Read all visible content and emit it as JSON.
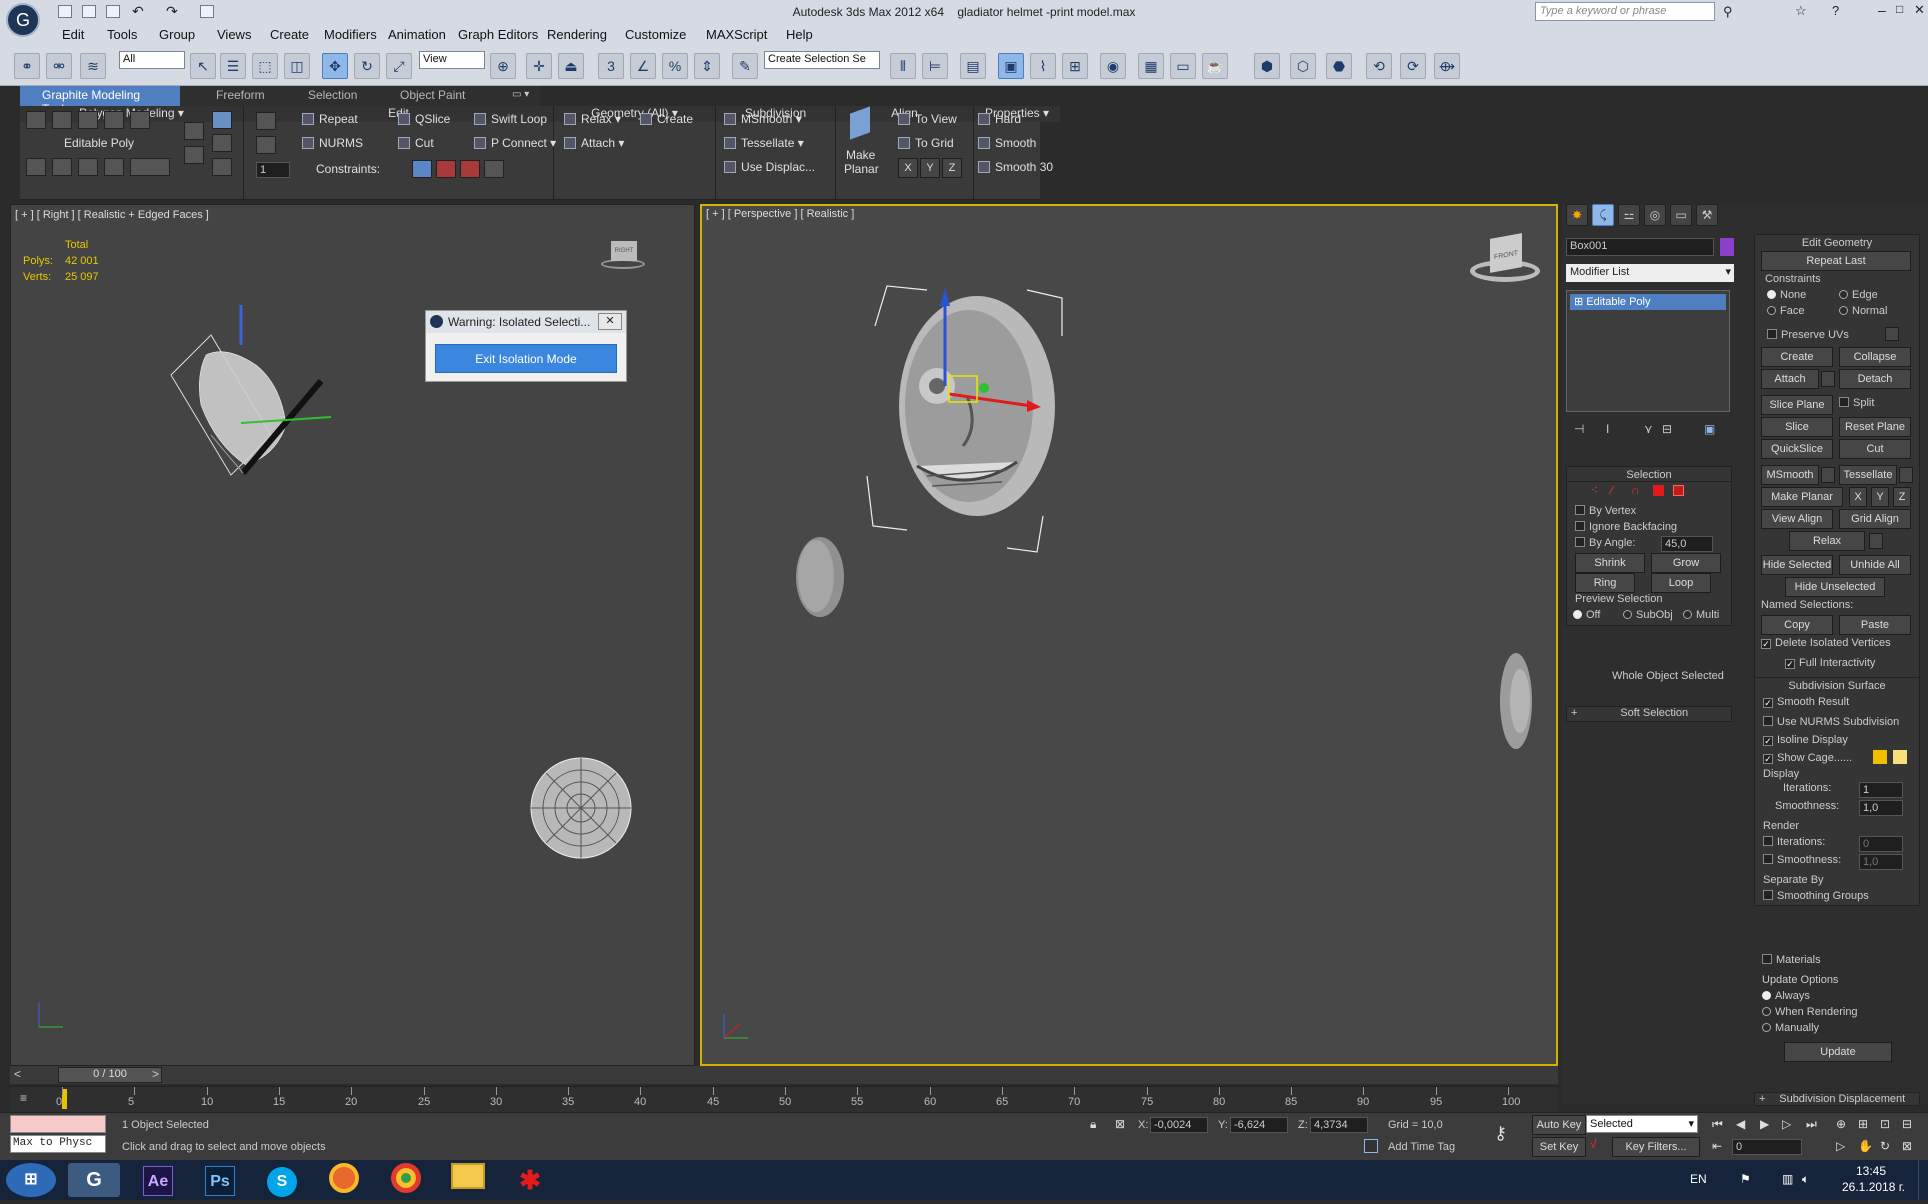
{
  "titlebar": {
    "app": "Autodesk 3ds Max  2012 x64",
    "file": "gladiator helmet -print model.max",
    "search_placeholder": "Type a keyword or phrase"
  },
  "menu": [
    "Edit",
    "Tools",
    "Group",
    "Views",
    "Create",
    "Modifiers",
    "Animation",
    "Graph Editors",
    "Rendering",
    "Customize",
    "MAXScript",
    "Help"
  ],
  "toolbar": {
    "selection_filter": "All",
    "ref_coord": "View",
    "named_selection": "Create Selection Se"
  },
  "ribbon_tabs": [
    "Graphite Modeling Tools",
    "Freeform",
    "Selection",
    "Object Paint"
  ],
  "ribbon": {
    "polygon_modeling": {
      "label": "Polygon Modeling",
      "sub": "Editable Poly",
      "spinner": "1"
    },
    "edit": {
      "label": "Edit",
      "repeat": "Repeat",
      "qslice": "QSlice",
      "swift_loop": "Swift Loop",
      "nurms": "NURMS",
      "cut": "Cut",
      "p_connect": "P Connect",
      "constraints": "Constraints:"
    },
    "geometry": {
      "label": "Geometry (All)",
      "relax": "Relax",
      "create": "Create",
      "attach": "Attach"
    },
    "subdivision": {
      "label": "Subdivision",
      "msmooth": "MSmooth",
      "tessellate": "Tessellate",
      "use_displace": "Use Displac..."
    },
    "align": {
      "label": "Align",
      "make_planar_1": "Make",
      "make_planar_2": "Planar",
      "to_view": "To View",
      "to_grid": "To Grid",
      "x": "X",
      "y": "Y",
      "z": "Z"
    },
    "properties": {
      "label": "Properties",
      "hard": "Hard",
      "smooth": "Smooth",
      "smooth30": "Smooth 30"
    }
  },
  "viewport_left": {
    "label": "[ + ] [ Right ] [ Realistic + Edged Faces ]",
    "stats_total": "Total",
    "polys_label": "Polys:",
    "polys": "42 001",
    "verts_label": "Verts:",
    "verts": "25 097",
    "viewcube": "RIGHT"
  },
  "viewport_right": {
    "label": "[ + ] [ Perspective ] [ Realistic ]",
    "viewcube": "FRONT"
  },
  "warning": {
    "title": "Warning: Isolated Selecti...",
    "button": "Exit Isolation Mode"
  },
  "command_panel": {
    "object_name": "Box001",
    "object_color": "#8e3fc9",
    "modifier_list": "Modifier List",
    "stack_item": "Editable Poly",
    "selection": {
      "title": "Selection",
      "by_vertex": "By Vertex",
      "ignore_backfacing": "Ignore Backfacing",
      "by_angle": "By Angle:",
      "angle": "45,0",
      "shrink": "Shrink",
      "grow": "Grow",
      "ring": "Ring",
      "loop": "Loop",
      "preview": "Preview Selection",
      "off": "Off",
      "subobj": "SubObj",
      "multi": "Multi",
      "whole": "Whole Object Selected"
    },
    "soft_selection": "Soft Selection",
    "edit_geometry": {
      "title": "Edit Geometry",
      "repeat_last": "Repeat Last",
      "constraints": "Constraints",
      "none": "None",
      "edge": "Edge",
      "face": "Face",
      "normal": "Normal",
      "preserve_uvs": "Preserve UVs",
      "create": "Create",
      "collapse": "Collapse",
      "attach": "Attach",
      "detach": "Detach",
      "slice_plane": "Slice Plane",
      "split": "Split",
      "slice": "Slice",
      "reset_plane": "Reset Plane",
      "quickslice": "QuickSlice",
      "cut": "Cut",
      "msmooth": "MSmooth",
      "tessellate": "Tessellate",
      "make_planar": "Make Planar",
      "x": "X",
      "y": "Y",
      "z": "Z",
      "view_align": "View Align",
      "grid_align": "Grid Align",
      "relax": "Relax",
      "hide_selected": "Hide Selected",
      "unhide_all": "Unhide All",
      "hide_unselected": "Hide Unselected",
      "named_selections": "Named Selections:",
      "copy": "Copy",
      "paste": "Paste",
      "delete_isolated": "Delete Isolated Vertices",
      "full_interactivity": "Full Interactivity"
    },
    "subdivision_surface": {
      "title": "Subdivision Surface",
      "smooth_result": "Smooth Result",
      "use_nurms": "Use NURMS Subdivision",
      "isoline": "Isoline Display",
      "show_cage": "Show Cage......",
      "display": "Display",
      "iterations": "Iterations:",
      "iter_val": "1",
      "smoothness": "Smoothness:",
      "smooth_val": "1,0",
      "render": "Render",
      "r_iter_val": "0",
      "r_smooth_val": "1,0",
      "separate_by": "Separate By",
      "smoothing_groups": "Smoothing Groups",
      "materials": "Materials",
      "update_options": "Update Options",
      "always": "Always",
      "when_rendering": "When Rendering",
      "manually": "Manually",
      "update": "Update"
    },
    "subdivision_displacement": "Subdivision Displacement"
  },
  "timeline": {
    "frame": "0 / 100",
    "ticks": [
      "0",
      "5",
      "10",
      "15",
      "20",
      "25",
      "30",
      "35",
      "40",
      "45",
      "50",
      "55",
      "60",
      "65",
      "70",
      "75",
      "80",
      "85",
      "90",
      "95",
      "100"
    ]
  },
  "status": {
    "maxscript": "Max to Physc",
    "selected": "1 Object Selected",
    "prompt": "Click and drag to select and move objects",
    "x_label": "X:",
    "x": "-0,0024",
    "y_label": "Y:",
    "y": "-6,624",
    "z_label": "Z:",
    "z": "4,3734",
    "grid": "Grid = 10,0",
    "add_time_tag": "Add Time Tag",
    "auto_key": "Auto Key",
    "set_key": "Set Key",
    "key_mode": "Selected",
    "key_filters": "Key Filters...",
    "frame": "0"
  },
  "taskbar": {
    "lang": "EN",
    "time": "13:45",
    "date": "26.1.2018 г.",
    "apps": [
      "Ae",
      "Ps"
    ]
  }
}
